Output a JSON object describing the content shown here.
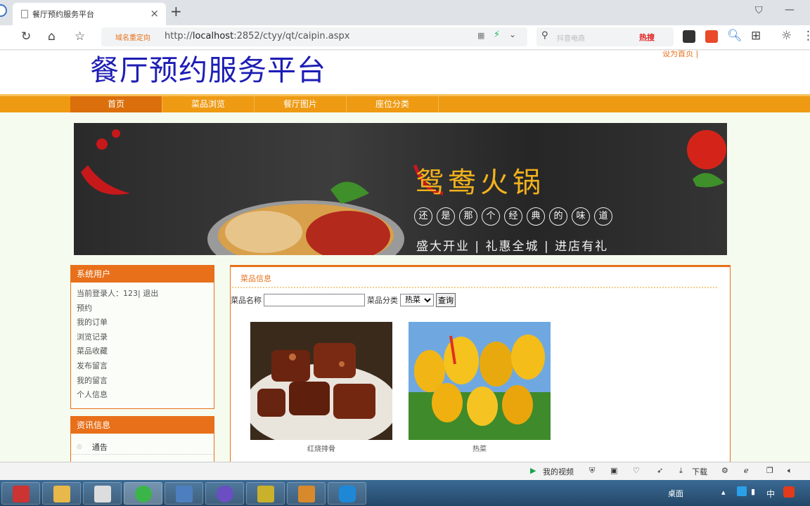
{
  "browser": {
    "tab_title": "餐厅预约服务平台",
    "tab_close": "×",
    "new_tab": "+",
    "address_tag": "域名重定向",
    "url_prefix": "http://",
    "url_host": "localhost",
    "url_rest": ":2852/ctyy/qt/caipin.aspx",
    "search_placeholder": "抖音电商",
    "hot_label": "热搜"
  },
  "site": {
    "title": "餐厅预约服务平台",
    "set_home": "设为首页 |",
    "nav": [
      {
        "label": "首页",
        "active": true
      },
      {
        "label": "菜品浏览"
      },
      {
        "label": "餐厅图片"
      },
      {
        "label": "座位分类"
      }
    ]
  },
  "banner": {
    "title": "鸳鸯火锅",
    "circles": [
      "还",
      "是",
      "那",
      "个",
      "经",
      "典",
      "的",
      "味",
      "道"
    ],
    "slogan": "盛大开业 | 礼惠全城 | 进店有礼"
  },
  "sidebar": {
    "user_box_title": "系统用户",
    "user_items": [
      "当前登录人：123| 退出",
      "预约",
      "我的订单",
      "浏览记录",
      "菜品收藏",
      "发布留言",
      "我的留言",
      "个人信息"
    ],
    "news_box_title": "资讯信息",
    "news_items": [
      "通告"
    ]
  },
  "content": {
    "title": "菜品信息",
    "name_label": "菜品名称",
    "category_label": "菜品分类",
    "category_selected": "热菜",
    "query_button": "查询",
    "dishes": [
      {
        "name": "红烧排骨"
      },
      {
        "name": "热菜"
      }
    ]
  },
  "statusbar": {
    "video": "我的视频",
    "download": "下载"
  },
  "taskbar": {
    "desktop": "桌面",
    "ime": "中"
  }
}
